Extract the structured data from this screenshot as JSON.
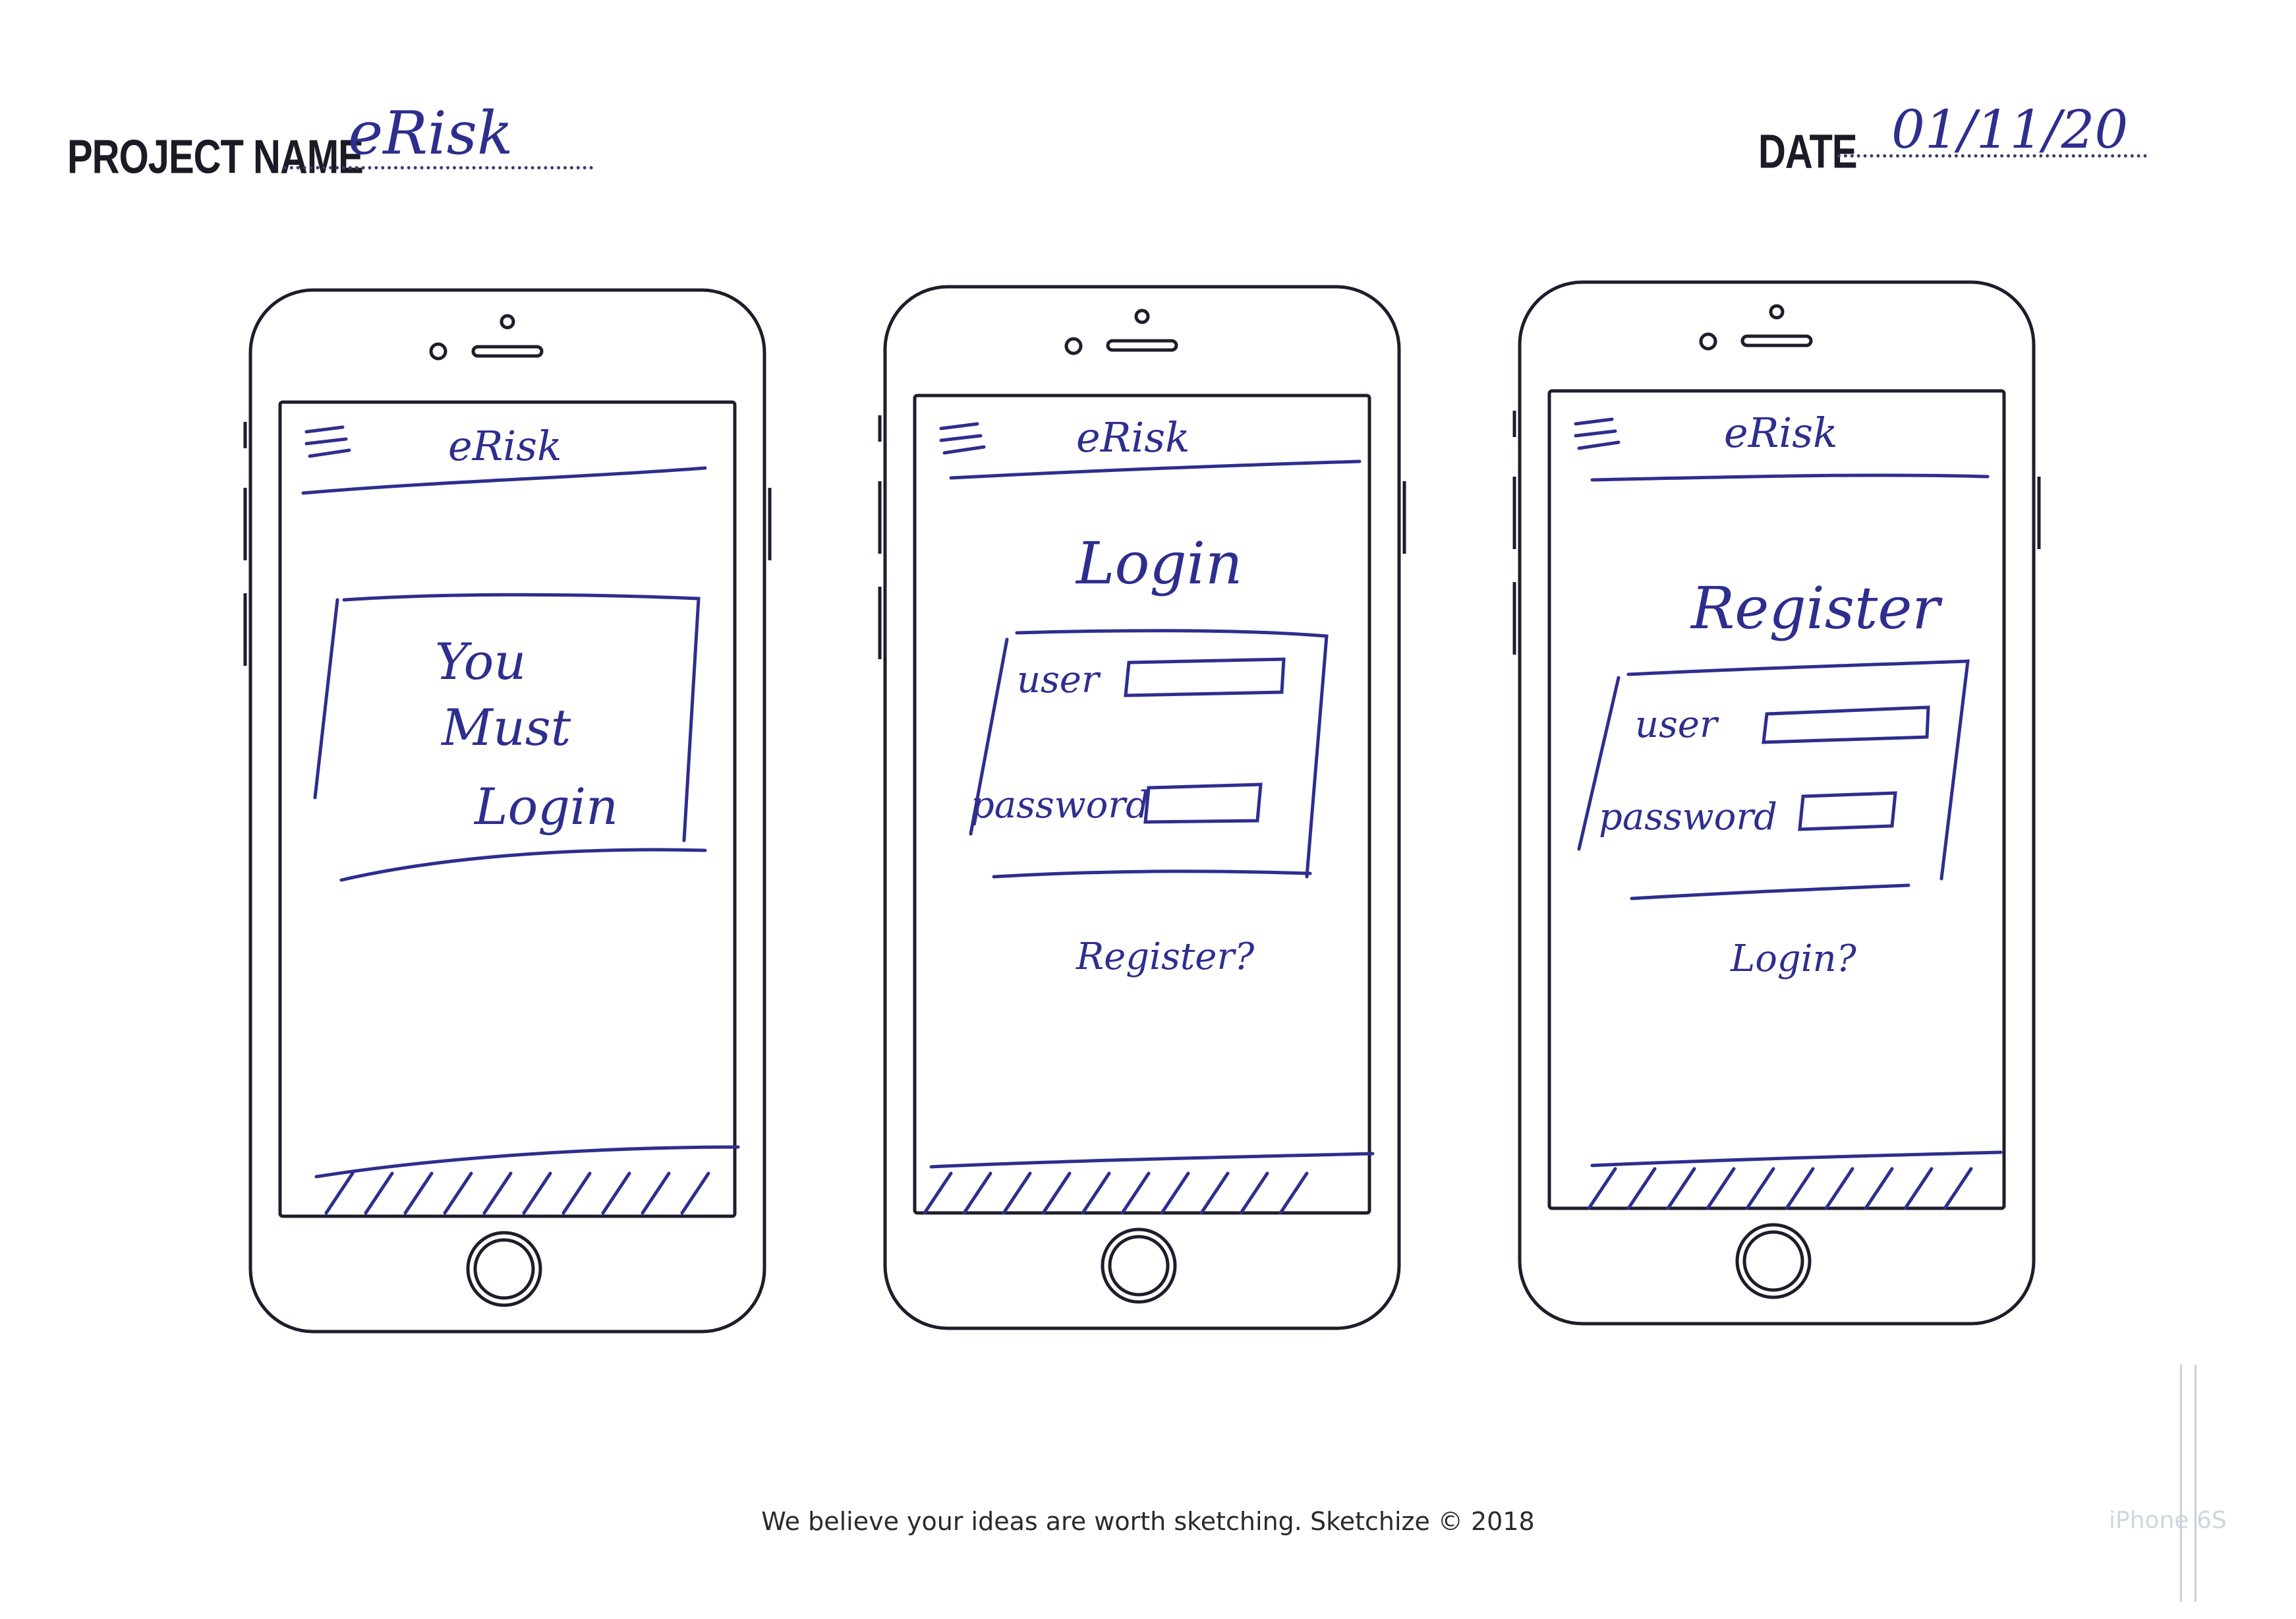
{
  "header": {
    "project_label": "PROJECT NAME",
    "project_value": "eRisk",
    "date_label": "DATE",
    "date_value": "01/11/20"
  },
  "phones": [
    {
      "app_title": "eRisk",
      "message": [
        "You",
        "Must",
        "Login"
      ]
    },
    {
      "app_title": "eRisk",
      "heading": "Login",
      "user_label": "user",
      "password_label": "password",
      "link": "Register?"
    },
    {
      "app_title": "eRisk",
      "heading": "Register",
      "user_label": "user",
      "password_label": "password",
      "link": "Login?"
    }
  ],
  "footer": "We believe your ideas are worth sketching. Sketchize © 2018",
  "device_model": "iPhone 6S",
  "colors": {
    "ink": "#2e2e8e",
    "outline": "#1f1d2b"
  }
}
